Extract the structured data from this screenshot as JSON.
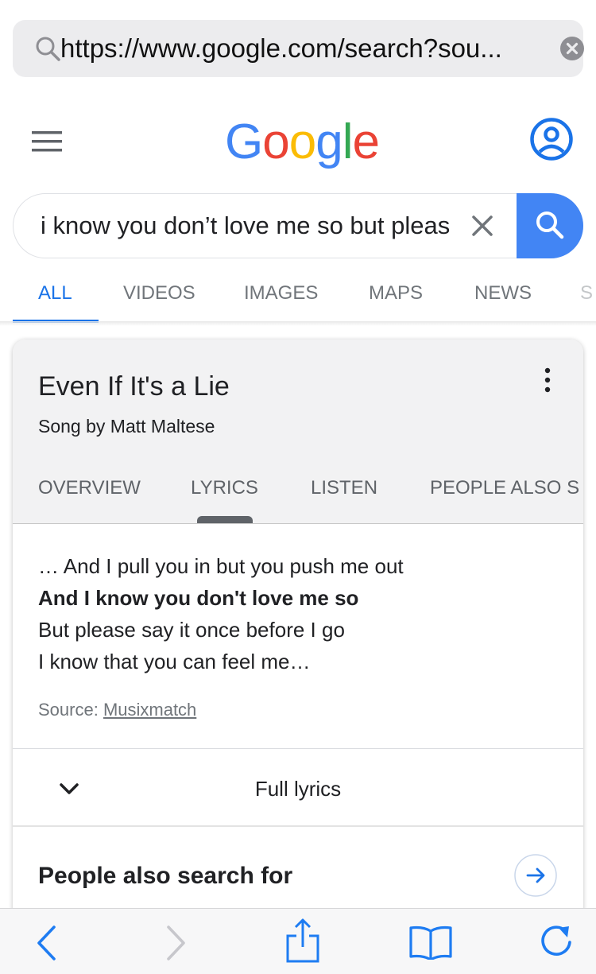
{
  "browser": {
    "url": "https://www.google.com/search?sou..."
  },
  "google": {
    "logo_letters": [
      {
        "char": "G",
        "color": "#4285f4"
      },
      {
        "char": "o",
        "color": "#ea4335"
      },
      {
        "char": "o",
        "color": "#fbbc05"
      },
      {
        "char": "g",
        "color": "#4285f4"
      },
      {
        "char": "l",
        "color": "#34a853"
      },
      {
        "char": "e",
        "color": "#ea4335"
      }
    ],
    "query": "i know you don’t love me so but pleas",
    "tabs": [
      "ALL",
      "VIDEOS",
      "IMAGES",
      "MAPS",
      "NEWS",
      "S"
    ],
    "active_tab": "ALL"
  },
  "card": {
    "title": "Even If It's a Lie",
    "subtitle": "Song by Matt Maltese",
    "tabs": [
      "OVERVIEW",
      "LYRICS",
      "LISTEN",
      "PEOPLE ALSO S"
    ],
    "active_tab": "LYRICS",
    "lyrics": [
      {
        "text": "… And I pull you in but you push me out",
        "bold": false
      },
      {
        "text": "And I know you don't love me so",
        "bold": true
      },
      {
        "text": "But please say it once before I go",
        "bold": false
      },
      {
        "text": "I know that you can feel me…",
        "bold": false
      }
    ],
    "source_label": "Source: ",
    "source_name": "Musixmatch",
    "full_lyrics_label": "Full lyrics",
    "people_also_search": "People also search for"
  },
  "colors": {
    "accent": "#1a73e8",
    "search_button": "#4285f4",
    "safari_blue": "#1e7cf2"
  },
  "toolbar": {
    "icons": [
      "back-icon",
      "forward-icon",
      "share-icon",
      "bookmarks-icon",
      "reload-icon"
    ]
  }
}
